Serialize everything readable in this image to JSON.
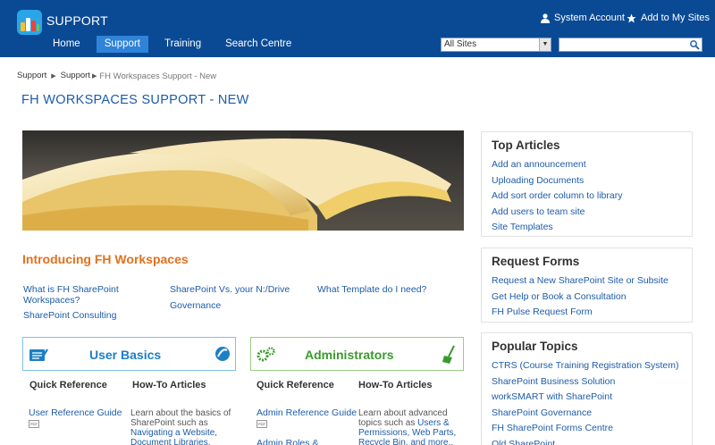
{
  "header": {
    "site_title": "SUPPORT",
    "system_account": "System Account",
    "add_to_my_sites": "Add to My Sites",
    "nav": [
      {
        "label": "Home",
        "active": false
      },
      {
        "label": "Support",
        "active": true
      },
      {
        "label": "Training",
        "active": false
      },
      {
        "label": "Search Centre",
        "active": false
      }
    ],
    "search_scope": "All Sites",
    "search_placeholder": ""
  },
  "breadcrumb": [
    "Support",
    "Support",
    "FH Workspaces Support - New"
  ],
  "page_title": "FH WORKSPACES SUPPORT - NEW",
  "intro": {
    "heading": "Introducing FH Workspaces",
    "links": [
      "What is FH SharePoint Workspaces?",
      "SharePoint Consulting",
      "SharePoint Vs. your N:/Drive",
      "Governance",
      "What Template do I need?"
    ]
  },
  "user_basics": {
    "title": "User Basics",
    "quick_reference": "Quick Reference",
    "how_to": "How-To Articles",
    "guide_link": "User Reference Guide",
    "desc_text": "Learn about the basics of SharePoint such as",
    "desc_links": "Navigating a Website, Document Libraries,"
  },
  "administrators": {
    "title": "Administrators",
    "quick_reference": "Quick Reference",
    "how_to": "How-To Articles",
    "guide_link": "Admin Reference Guide",
    "guide_link_2": "Admin Roles &",
    "desc_text": "Learn about advanced topics such as",
    "desc_links": "Users & Permissions, Web Parts, Recycle Bin, and more.."
  },
  "top_articles": {
    "title": "Top Articles",
    "items": [
      "Add an announcement",
      "Uploading Documents",
      "Add sort order column to library",
      "Add users to team site",
      "Site Templates"
    ]
  },
  "request_forms": {
    "title": "Request Forms",
    "items": [
      "Request a New SharePoint Site or Subsite",
      "Get Help or Book a Consultation",
      "FH Pulse Request Form"
    ]
  },
  "popular_topics": {
    "title": "Popular Topics",
    "items": [
      "CTRS (Course Training Registration System)",
      "SharePoint Business Solution",
      "workSMART with SharePoint",
      "SharePoint Governance",
      "FH SharePoint Forms Centre",
      "Old SharePoint"
    ]
  },
  "colors": {
    "header_bg": "#0a4a95",
    "nav_active": "#2f83d8",
    "link": "#1d5ca8",
    "intro_heading": "#e2711d",
    "user_basics": "#1d7fc4",
    "administrators": "#3a9a2c"
  }
}
